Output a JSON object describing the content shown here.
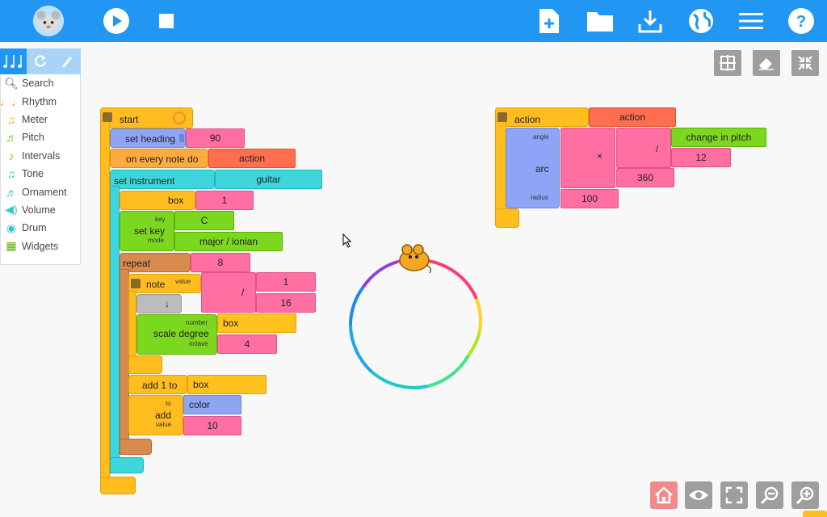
{
  "toolbar": {
    "icons": [
      "mouse-logo-icon",
      "play-icon",
      "stop-icon",
      "new-project-icon",
      "open-folder-icon",
      "download-icon",
      "globe-icon",
      "menu-icon",
      "help-icon"
    ]
  },
  "palette": {
    "items": [
      {
        "label": "Search"
      },
      {
        "label": "Rhythm"
      },
      {
        "label": "Meter"
      },
      {
        "label": "Pitch"
      },
      {
        "label": "Intervals"
      },
      {
        "label": "Tone"
      },
      {
        "label": "Ornament"
      },
      {
        "label": "Volume"
      },
      {
        "label": "Drum"
      },
      {
        "label": "Widgets"
      }
    ]
  },
  "blocks": {
    "start": "start",
    "set_heading": "set heading",
    "set_heading_val": "90",
    "on_every_note": "on every note do",
    "on_every_note_val": "action",
    "set_instrument": "set instrument",
    "set_instrument_val": "guitar",
    "box_label": "box",
    "box_val": "1",
    "set_key": "set key",
    "key_arg": "key",
    "key_val": "C",
    "mode_arg": "mode",
    "mode_val": "major / ionian",
    "repeat": "repeat",
    "repeat_val": "8",
    "note": "note",
    "note_value_arg": "value",
    "divide_sym": "/",
    "num1": "1",
    "num16": "16",
    "down_arrow": "↓",
    "scale_degree": "scale degree",
    "number_arg": "number",
    "number_val": "box",
    "octave_arg": "octave",
    "octave_val": "4",
    "add1": "add 1 to",
    "add1_val": "box",
    "add": "add",
    "to_arg": "to",
    "to_val": "color",
    "value_arg": "value",
    "add_val": "10",
    "action_hat": "action",
    "action_name": "action",
    "arc": "arc",
    "angle_arg": "angle",
    "radius_arg": "radius",
    "radius_val": "100",
    "times_sym": "×",
    "div2_sym": "/",
    "change_in_pitch": "change in pitch",
    "val12": "12",
    "val360": "360"
  }
}
